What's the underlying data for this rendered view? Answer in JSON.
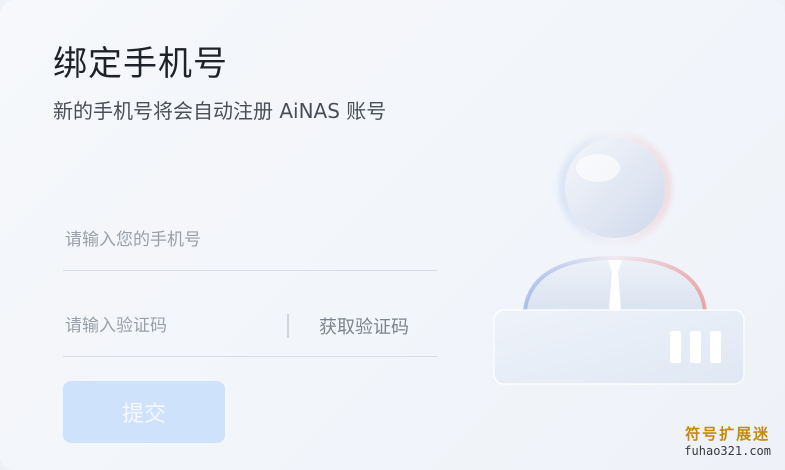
{
  "dialog": {
    "title": "绑定手机号",
    "subtitle": "新的手机号将会自动注册 AiNAS 账号"
  },
  "form": {
    "phone_placeholder": "请输入您的手机号",
    "phone_value": "",
    "code_placeholder": "请输入验证码",
    "code_value": "",
    "get_code_label": "获取验证码",
    "submit_label": "提交",
    "submit_enabled": false
  },
  "colors": {
    "submit_bg": "#cfe2fb",
    "accent_red": "#e88a8a",
    "accent_blue": "#8fb0e8"
  },
  "icons": {
    "illustration": "user-avatar-with-card-icon"
  },
  "watermark": {
    "title": "符号扩展迷",
    "url": "fuhao321.com"
  }
}
